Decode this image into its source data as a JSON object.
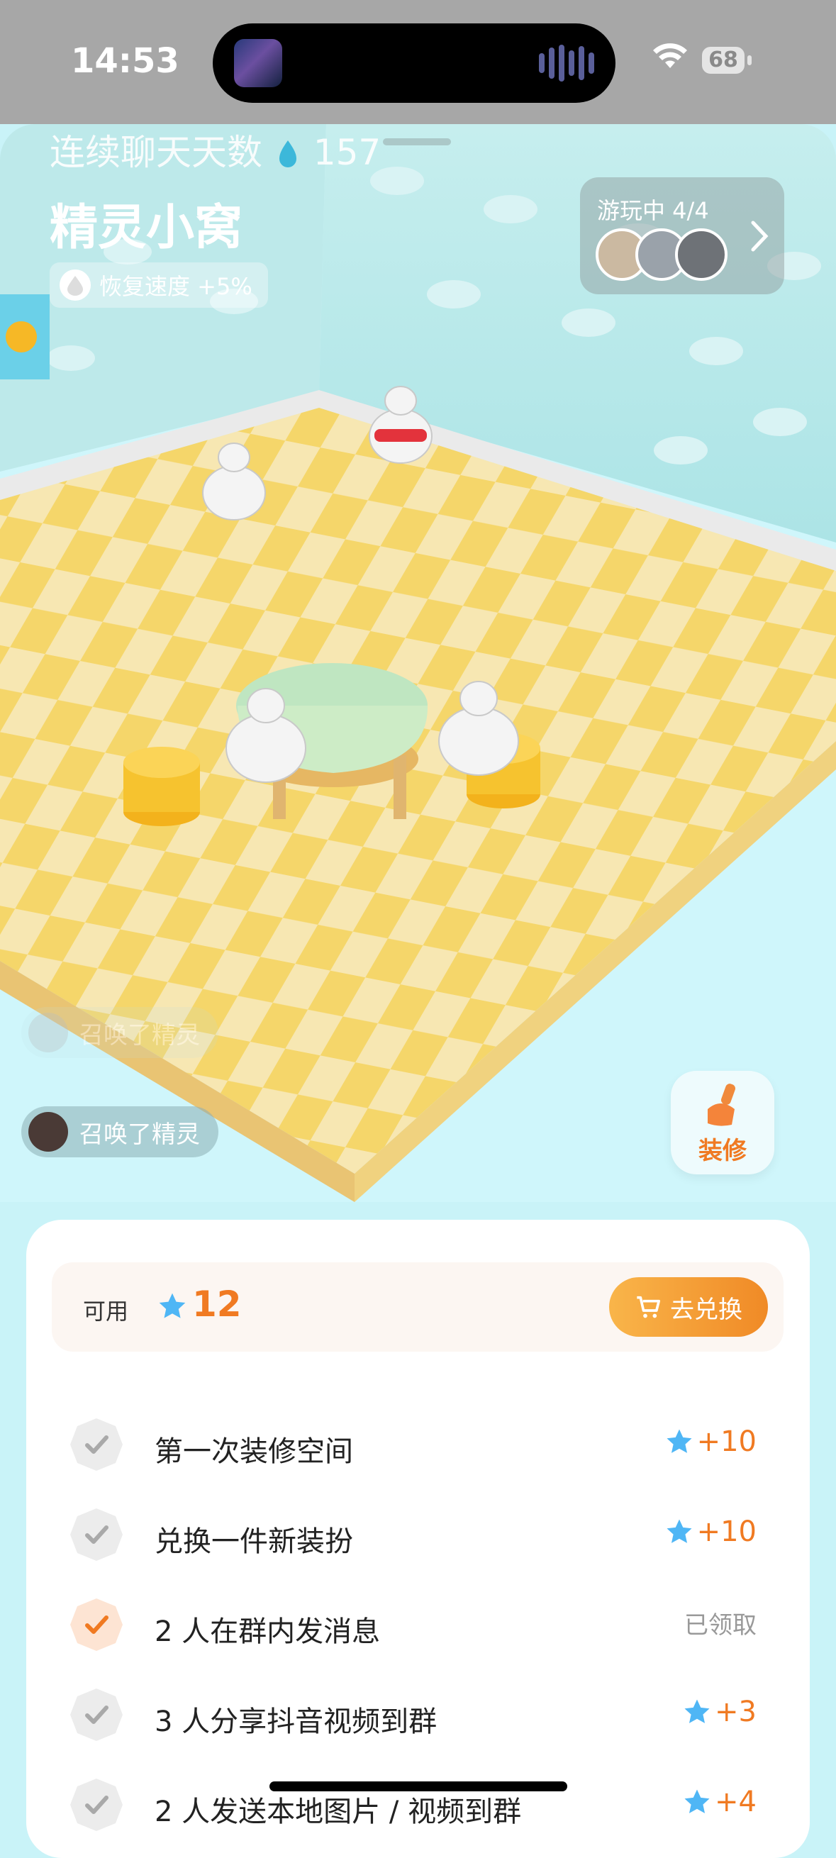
{
  "status_bar": {
    "time": "14:53",
    "battery": "68"
  },
  "header": {
    "streak_label": "连续聊天天数",
    "streak_count": "157",
    "room_title": "精灵小窝",
    "speed_bonus": "恢复速度 +5%",
    "playing_label": "游玩中 4/4"
  },
  "feed": [
    {
      "text": "召唤了精灵"
    },
    {
      "text": "召唤了精灵"
    }
  ],
  "decor_button": {
    "label": "装修"
  },
  "points": {
    "available_label": "可用",
    "value": "12",
    "exchange_label": "去兑换"
  },
  "tasks": [
    {
      "label": "第一次装修空间",
      "reward": "+10",
      "done": false
    },
    {
      "label": "兑换一件新装扮",
      "reward": "+10",
      "done": false
    },
    {
      "label": "2 人在群内发消息",
      "reward": "已领取",
      "done": true
    },
    {
      "label": "3 人分享抖音视频到群",
      "reward": "+3",
      "done": false
    },
    {
      "label": "2 人发送本地图片 / 视频到群",
      "reward": "+4",
      "done": false
    }
  ],
  "colors": {
    "accent": "#f07a22",
    "star": "#4fb6f5",
    "wall": "#b7e9ea",
    "floor": "#f3d774"
  }
}
